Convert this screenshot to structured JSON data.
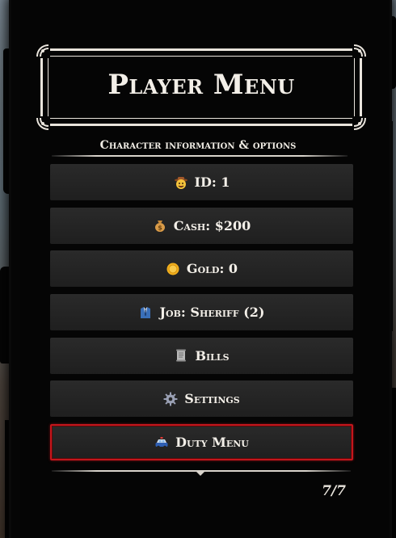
{
  "menu": {
    "title": "Player Menu",
    "subtitle": "Character information & options",
    "items": [
      {
        "label": "ID: 1",
        "icon": "cowboy-face-icon"
      },
      {
        "label": "Cash: $200",
        "icon": "money-bag-icon"
      },
      {
        "label": "Gold: 0",
        "icon": "gold-coin-icon"
      },
      {
        "label": "Job: Sheriff (2)",
        "icon": "suit-icon"
      },
      {
        "label": "Bills",
        "icon": "scroll-icon"
      },
      {
        "label": "Settings",
        "icon": "gear-icon"
      },
      {
        "label": "Duty Menu",
        "icon": "police-car-icon"
      }
    ],
    "selected_index": 6,
    "page_counter": "7/7"
  },
  "colors": {
    "panel": "#050505",
    "item_bg": "#262626",
    "text": "#f3efe8",
    "selection_border": "#c4161c"
  }
}
